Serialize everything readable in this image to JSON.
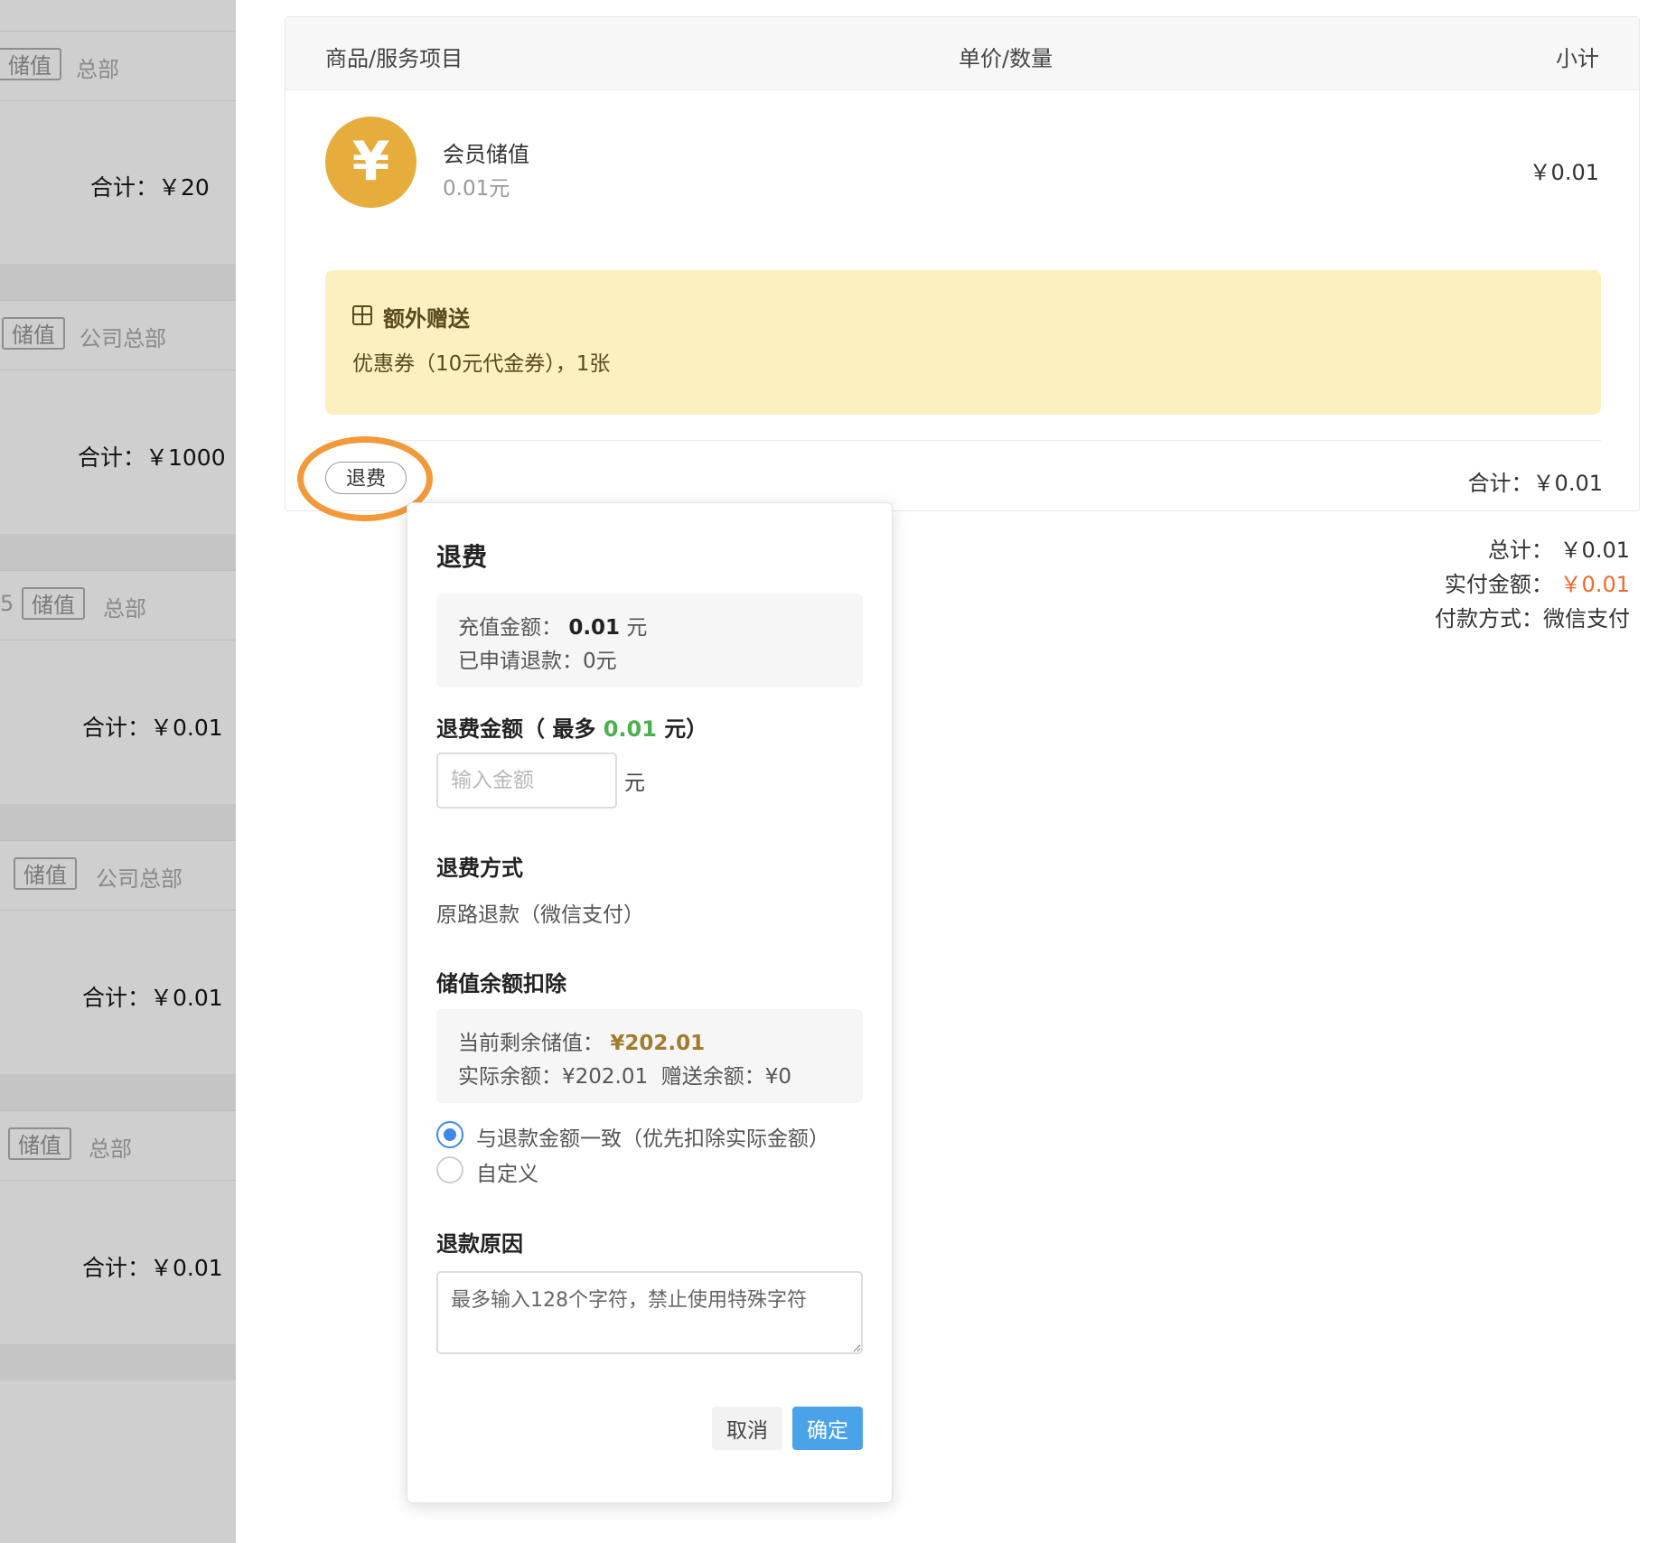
{
  "left_list": {
    "blocks": [
      {
        "edge": "",
        "tag": "储值",
        "org": "总部",
        "total": "合计：￥20"
      },
      {
        "edge": "",
        "tag": "储值",
        "org": "公司总部",
        "total": "合计：￥1000"
      },
      {
        "edge": "5",
        "tag": "储值",
        "org": "总部",
        "total": "合计：￥0.01"
      },
      {
        "edge": "",
        "tag": "储值",
        "org": "公司总部",
        "total": "合计：￥0.01"
      },
      {
        "edge": "",
        "tag": "储值",
        "org": "总部",
        "total": "合计：￥0.01"
      }
    ]
  },
  "order": {
    "headers": {
      "item": "商品/服务项目",
      "price_qty": "单价/数量",
      "subtotal": "小计"
    },
    "item": {
      "icon_symbol": "¥",
      "name": "会员储值",
      "price": "0.01元",
      "subtotal": "￥0.01"
    },
    "gift": {
      "title": "额外赠送",
      "desc": "优惠券（10元代金券），1张"
    },
    "refund_button": "退费",
    "total": "合计：￥0.01"
  },
  "summary": {
    "total_label": "总计：",
    "total_value": "￥0.01",
    "paid_label": "实付金额：",
    "paid_value": "￥0.01",
    "method_label": "付款方式：",
    "method_value": "微信支付"
  },
  "popover": {
    "title": "退费",
    "recharge_label": "充值金额：",
    "recharge_value": "0.01",
    "recharge_unit": "元",
    "applied_label": "已申请退款：",
    "applied_value": "0元",
    "amount_label_pre": "退费金额（ 最多",
    "amount_max": "0.01",
    "amount_label_post": "元）",
    "amount_placeholder": "输入金额",
    "amount_unit": "元",
    "method_label": "退费方式",
    "method_value": "原路退款（微信支付）",
    "deduct_label": "储值余额扣除",
    "balance_label": "当前剩余储值：",
    "balance_value": "¥202.01",
    "actual_balance": "实际余额：¥202.01",
    "gift_balance": "赠送余额：¥0",
    "radio_options": [
      "与退款金额一致（优先扣除实际金额）",
      "自定义"
    ],
    "reason_label": "退款原因",
    "reason_placeholder": "最多输入128个字符，禁止使用特殊字符",
    "cancel": "取消",
    "confirm": "确定"
  },
  "colors": {
    "accent": "#4aa3e8",
    "coin": "#e6ad3c",
    "highlight": "#f29a3a",
    "paid": "#ef6a2d",
    "gift_bg": "#fcefc0"
  }
}
